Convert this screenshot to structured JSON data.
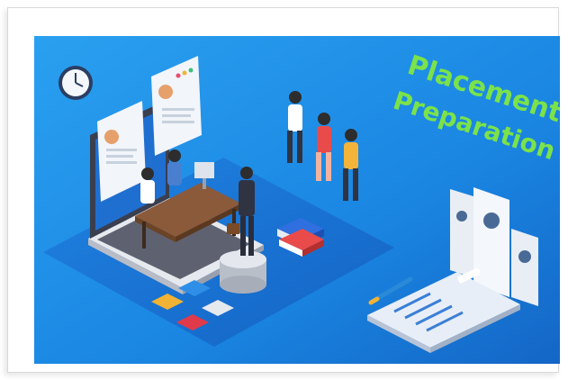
{
  "headline": {
    "line1": "Placement",
    "line2": "Preparation"
  },
  "colors": {
    "background_blue": "#1e8be6",
    "background_dark": "#1566c4",
    "floor_blue": "#1a72d6",
    "headline_green": "#7be24a",
    "laptop_gray": "#6d6f78",
    "desk_brown": "#8a5a3a"
  }
}
